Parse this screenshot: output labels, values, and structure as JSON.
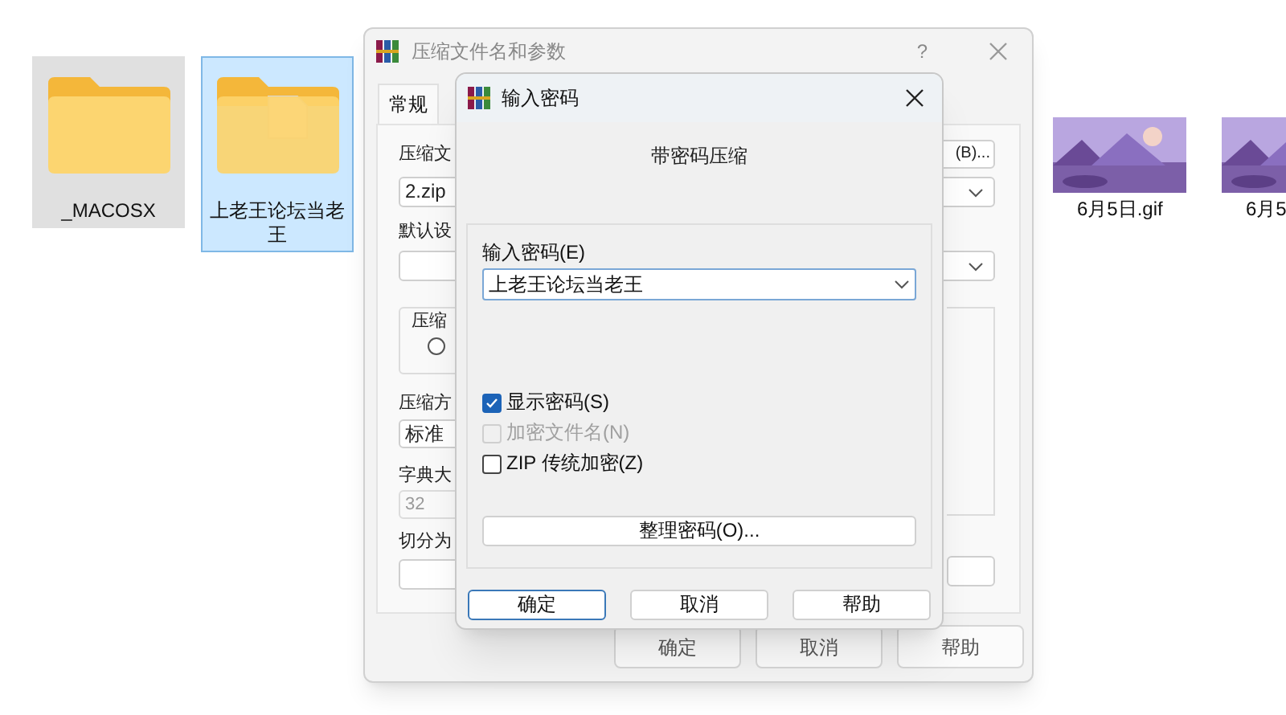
{
  "files": [
    {
      "kind": "folder",
      "name": "_MACOSX",
      "selected": false,
      "hovered": true,
      "has_content": false
    },
    {
      "kind": "folder",
      "name": "上老王论坛当老王",
      "selected": true,
      "hovered": false,
      "has_content": true
    },
    {
      "kind": "picture",
      "name": "6月5日.gif",
      "selected": false,
      "hovered": false
    },
    {
      "kind": "picture",
      "name": "6月5",
      "selected": false,
      "hovered": false
    }
  ],
  "back_dialog": {
    "title": "压缩文件名和参数",
    "help": "?",
    "tabs": [
      {
        "label": "常规",
        "selected": true
      }
    ],
    "archive_label": "压缩文",
    "browse_button": "(B)...",
    "archive_value": "2.zip",
    "profile_label": "默认设",
    "format_group": "压缩",
    "format_option": {
      "selected": false
    },
    "method_label": "压缩方",
    "method_value": "标准",
    "dict_label": "字典大",
    "dict_value": "32",
    "split_label": "切分为",
    "buttons": [
      "确定",
      "取消",
      "帮助"
    ]
  },
  "password_dialog": {
    "title": "输入密码",
    "heading": "带密码压缩",
    "password_label": "输入密码(E)",
    "password_value": "上老王论坛当老王",
    "options": [
      {
        "label": "显示密码(S)",
        "checked": true,
        "disabled": false
      },
      {
        "label": "加密文件名(N)",
        "checked": false,
        "disabled": true
      },
      {
        "label": "ZIP 传统加密(Z)",
        "checked": false,
        "disabled": false
      }
    ],
    "organize_button": "整理密码(O)...",
    "buttons": [
      {
        "label": "确定",
        "default": true
      },
      {
        "label": "取消",
        "default": false
      },
      {
        "label": "帮助",
        "default": false
      }
    ]
  }
}
